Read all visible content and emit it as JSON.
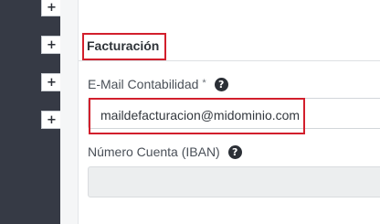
{
  "sidebar": {
    "expand_buttons": [
      {
        "label": "+"
      },
      {
        "label": "+"
      },
      {
        "label": "+"
      },
      {
        "label": "+"
      }
    ]
  },
  "section": {
    "title": "Facturación"
  },
  "fields": {
    "email": {
      "label": "E-Mail Contabilidad",
      "required_mark": "*",
      "help_icon": "question-circle-icon",
      "help_glyph": "?",
      "value": "maildefacturacion@midominio.com"
    },
    "iban": {
      "label": "Número Cuenta (IBAN)",
      "help_icon": "question-circle-icon",
      "help_glyph": "?",
      "value": ""
    }
  },
  "colors": {
    "sidebar_bg": "#363a45",
    "highlight": "#d21f2c",
    "disabled_input_bg": "#eceeef"
  }
}
